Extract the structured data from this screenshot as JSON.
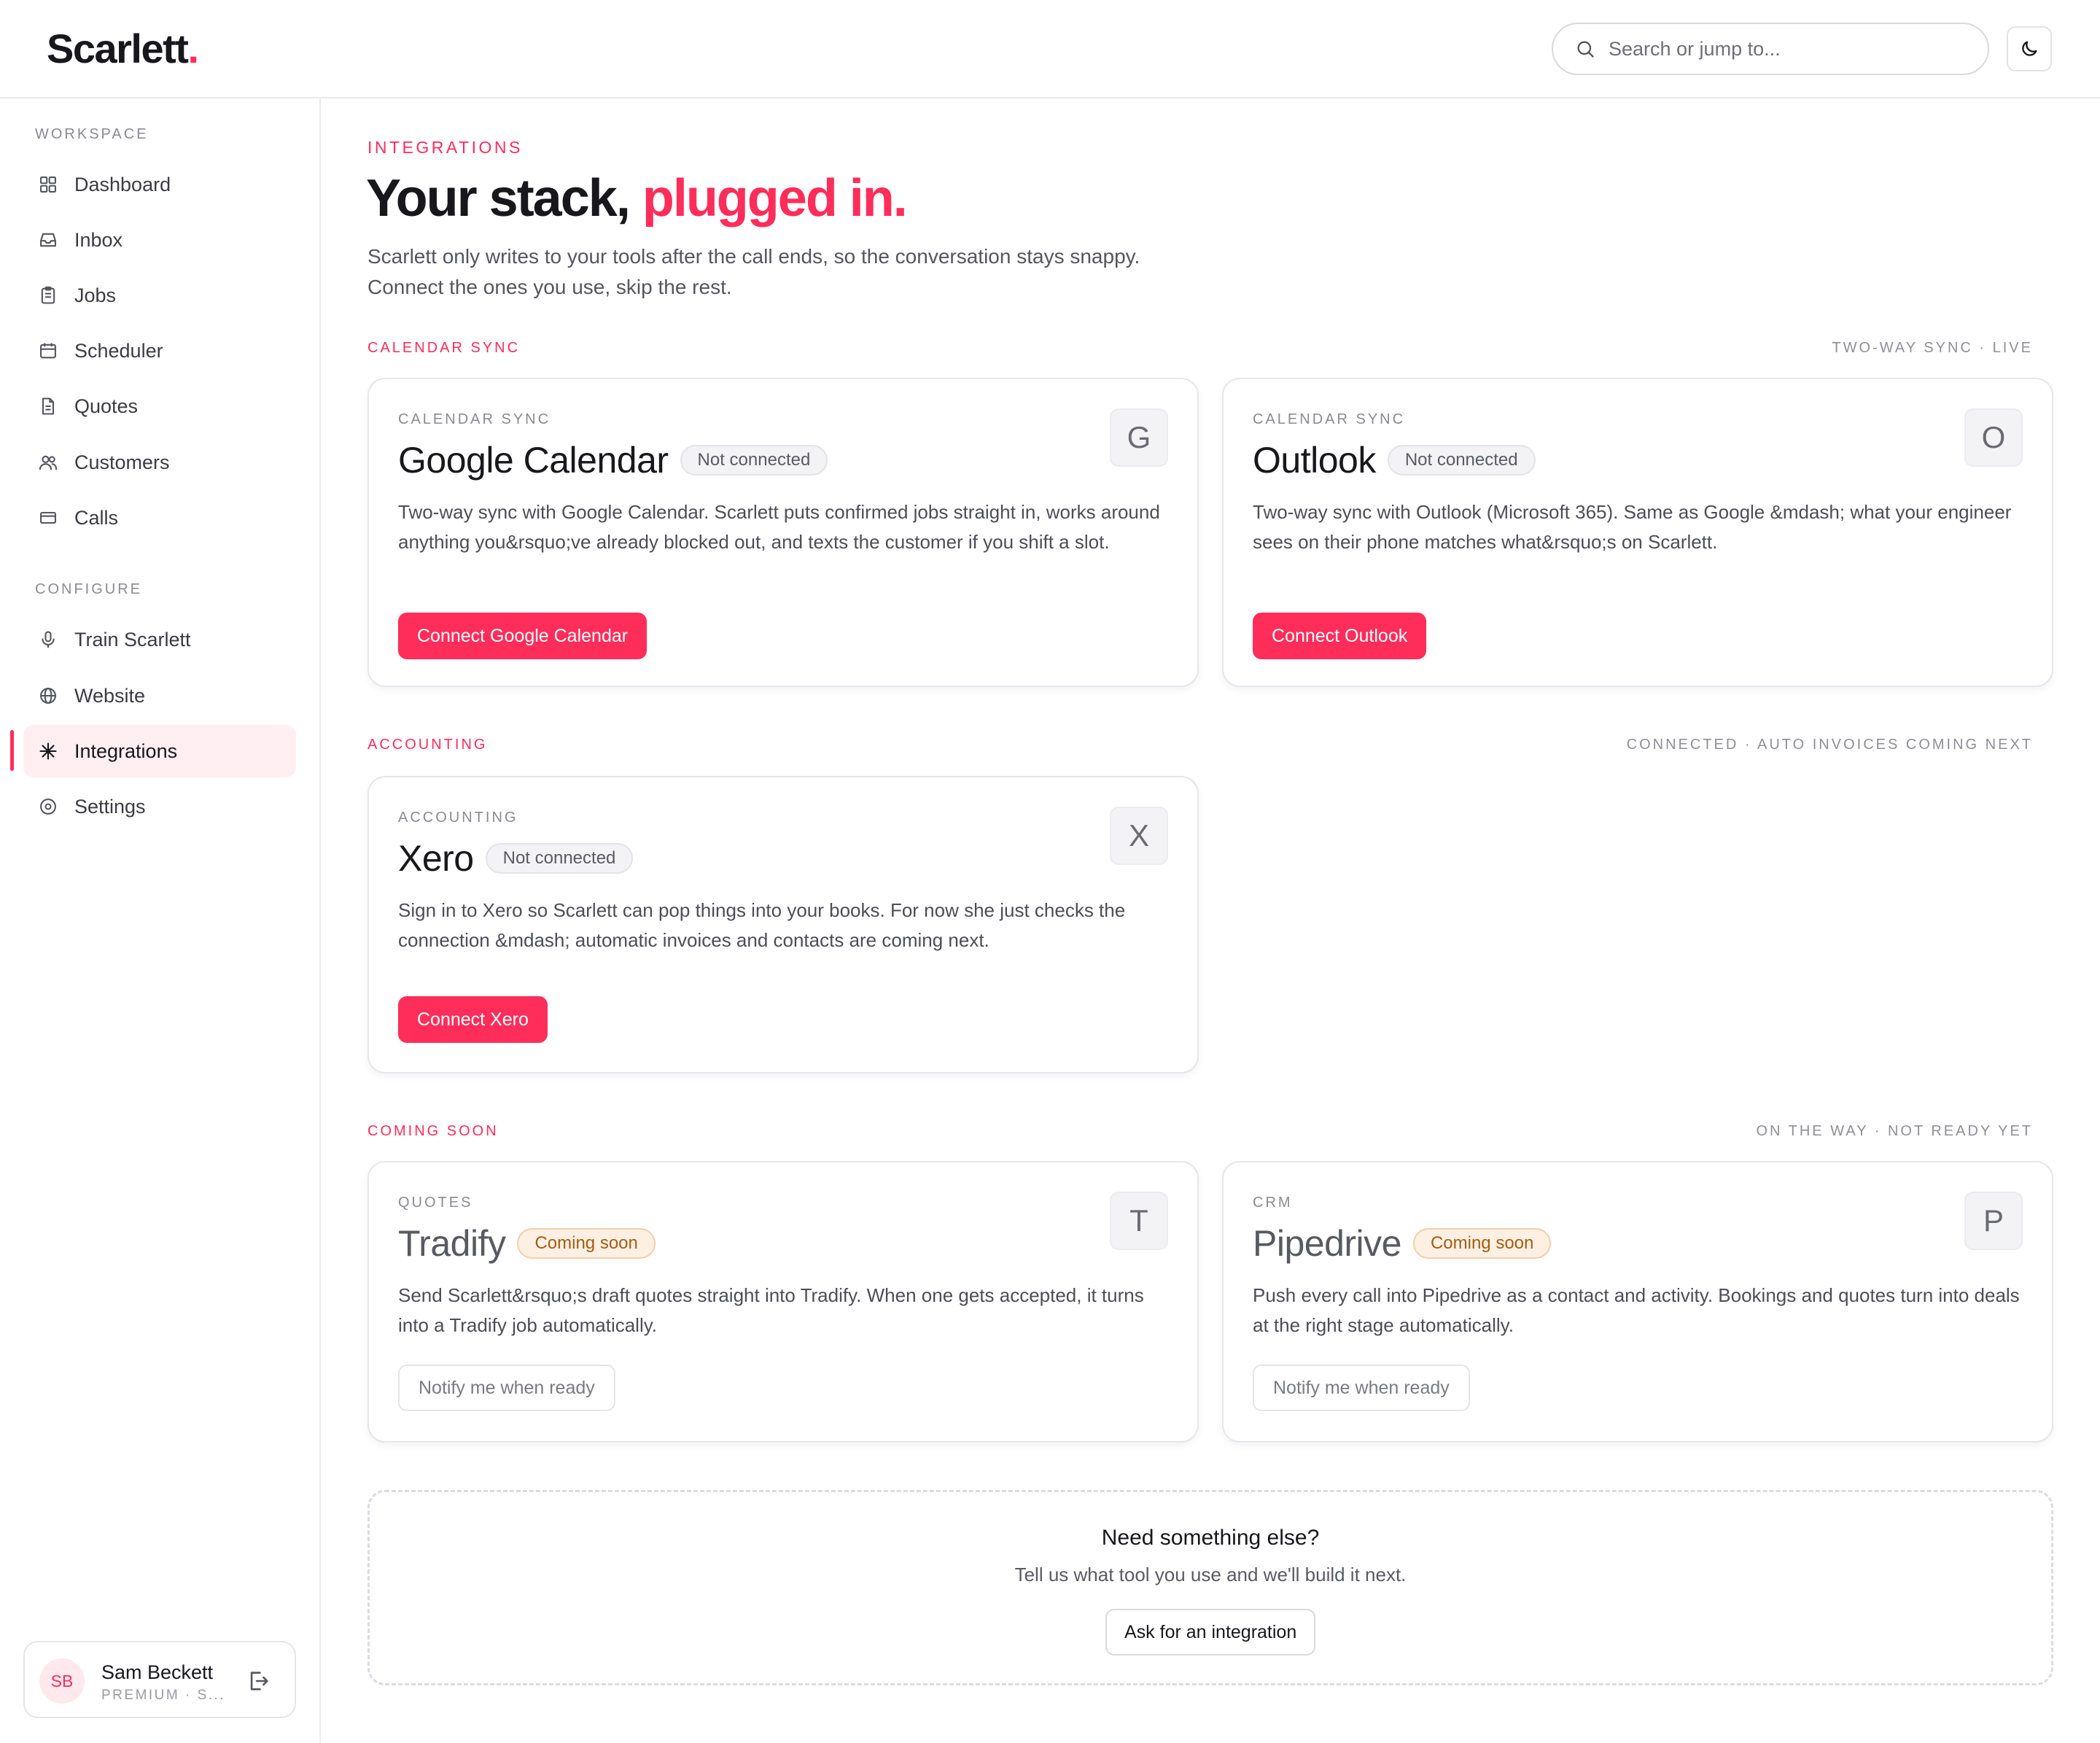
{
  "app": {
    "logo_text": "Scarlett",
    "logo_dot": ".",
    "accent_color": "#ff2d5a"
  },
  "header": {
    "search_placeholder": "Search or jump to...",
    "search_icon": "search-icon",
    "theme_toggle_icon": "moon-icon"
  },
  "sidebar": {
    "workspace_heading": "WORKSPACE",
    "workspace_items": [
      {
        "label": "Dashboard",
        "icon": "grid-icon"
      },
      {
        "label": "Inbox",
        "icon": "inbox-icon"
      },
      {
        "label": "Jobs",
        "icon": "clipboard-icon"
      },
      {
        "label": "Scheduler",
        "icon": "calendar-icon"
      },
      {
        "label": "Quotes",
        "icon": "document-icon"
      },
      {
        "label": "Customers",
        "icon": "users-icon"
      },
      {
        "label": "Calls",
        "icon": "card-icon"
      }
    ],
    "configure_heading": "CONFIGURE",
    "configure_items": [
      {
        "label": "Train Scarlett",
        "icon": "microphone-icon"
      },
      {
        "label": "Website",
        "icon": "globe-icon"
      },
      {
        "label": "Integrations",
        "icon": "sparkle-icon",
        "active": true
      },
      {
        "label": "Settings",
        "icon": "settings-icon"
      }
    ],
    "user": {
      "initials": "SB",
      "name": "Sam Beckett",
      "plan": "PREMIUM · S...",
      "logout_icon": "logout-icon"
    }
  },
  "main": {
    "eyebrow": "INTEGRATIONS",
    "title_plain": "Your stack,",
    "title_highlight": "plugged in.",
    "subtitle": "Scarlett only writes to your tools after the call ends, so the conversation stays snappy. Connect the ones you use, skip the rest.",
    "sections": {
      "calendar": {
        "label": "CALENDAR SYNC",
        "meta": "TWO-WAY SYNC · LIVE",
        "cards": [
          {
            "category": "CALENDAR SYNC",
            "name": "Google Calendar",
            "status": "Not connected",
            "logo_letter": "G",
            "description": "Two-way sync with Google Calendar. Scarlett puts confirmed jobs straight in, works around anything you&rsquo;ve already blocked out, and texts the customer if you shift a slot.",
            "button": "Connect Google Calendar"
          },
          {
            "category": "CALENDAR SYNC",
            "name": "Outlook",
            "status": "Not connected",
            "logo_letter": "O",
            "description": "Two-way sync with Outlook (Microsoft 365). Same as Google &mdash; what your engineer sees on their phone matches what&rsquo;s on Scarlett.",
            "button": "Connect Outlook"
          }
        ]
      },
      "accounting": {
        "label": "ACCOUNTING",
        "meta": "CONNECTED · AUTO INVOICES COMING NEXT",
        "cards": [
          {
            "category": "ACCOUNTING",
            "name": "Xero",
            "status": "Not connected",
            "logo_letter": "X",
            "description": "Sign in to Xero so Scarlett can pop things into your books. For now she just checks the connection &mdash; automatic invoices and contacts are coming next.",
            "button": "Connect Xero"
          }
        ]
      },
      "coming_soon": {
        "label": "COMING SOON",
        "meta": "ON THE WAY · NOT READY YET",
        "cards": [
          {
            "category": "QUOTES",
            "name": "Tradify",
            "status": "Coming soon",
            "logo_letter": "T",
            "description": "Send Scarlett&rsquo;s draft quotes straight into Tradify. When one gets accepted, it turns into a Tradify job automatically.",
            "button": "Notify me when ready"
          },
          {
            "category": "CRM",
            "name": "Pipedrive",
            "status": "Coming soon",
            "logo_letter": "P",
            "description": "Push every call into Pipedrive as a contact and activity. Bookings and quotes turn into deals at the right stage automatically.",
            "button": "Notify me when ready"
          }
        ]
      }
    },
    "request": {
      "title": "Need something else?",
      "subtitle": "Tell us what tool you use and we'll build it next.",
      "button": "Ask for an integration"
    }
  }
}
